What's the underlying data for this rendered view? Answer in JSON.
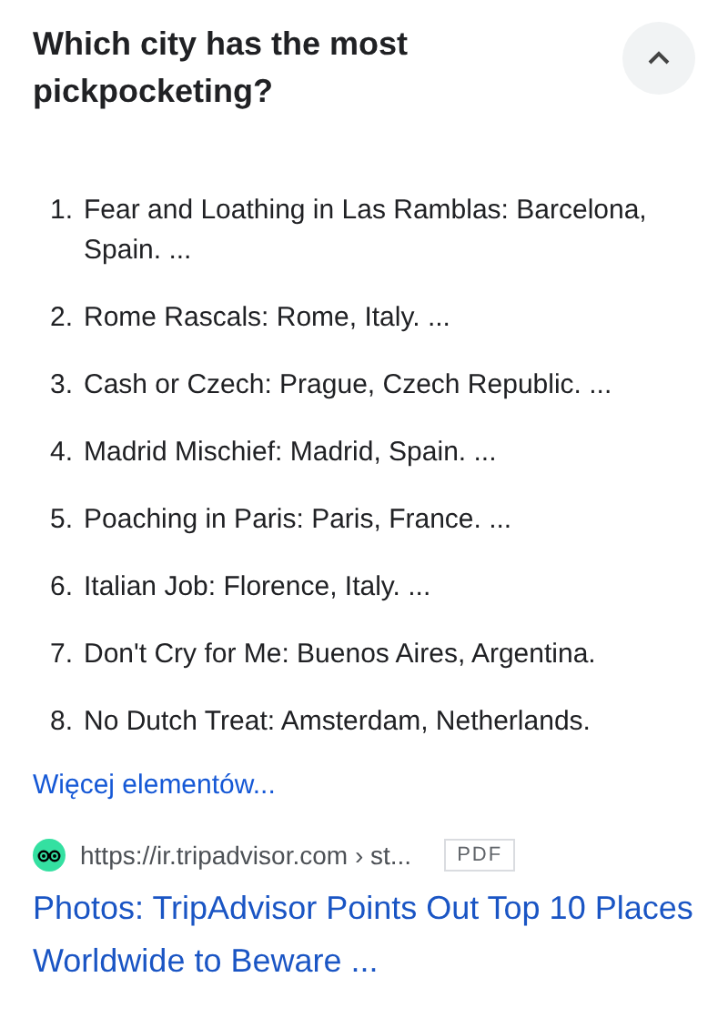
{
  "question": {
    "title": "Which city has the most pickpocketing?",
    "expanded": true
  },
  "answer_list": [
    {
      "number": "1.",
      "text": "Fear and Loathing in Las Ramblas: Barcelona, Spain. ..."
    },
    {
      "number": "2.",
      "text": "Rome Rascals: Rome, Italy. ..."
    },
    {
      "number": "3.",
      "text": "Cash or Czech: Prague, Czech Republic. ..."
    },
    {
      "number": "4.",
      "text": "Madrid Mischief: Madrid, Spain. ..."
    },
    {
      "number": "5.",
      "text": "Poaching in Paris: Paris, France. ..."
    },
    {
      "number": "6.",
      "text": "Italian Job: Florence, Italy. ..."
    },
    {
      "number": "7.",
      "text": "Don't Cry for Me: Buenos Aires, Argentina."
    },
    {
      "number": "8.",
      "text": "No Dutch Treat: Amsterdam, Netherlands."
    }
  ],
  "more_link": "Więcej elementów...",
  "source": {
    "url": "https://ir.tripadvisor.com › st...",
    "badge": "PDF",
    "title": "Photos: TripAdvisor Points Out Top 10 Places Worldwide to Beware ..."
  }
}
